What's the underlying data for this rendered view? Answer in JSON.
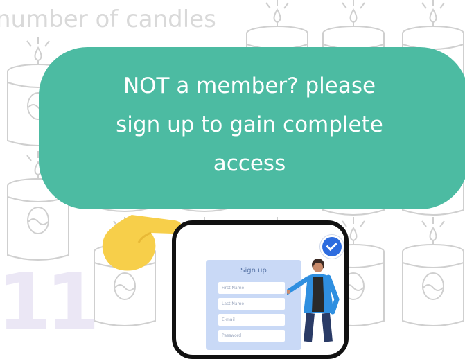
{
  "background": {
    "title": "number of candles",
    "count": "11"
  },
  "banner": {
    "line1": "NOT a member? please",
    "line2": "sign up to gain complete",
    "line3": "access"
  },
  "signup": {
    "title": "Sign up",
    "fields": [
      "First Name",
      "Last Name",
      "E-mail",
      "Password"
    ]
  },
  "colors": {
    "banner": "#4cbba2",
    "hand": "#f7cf4a",
    "card": "#c9d9f6",
    "check": "#2d6cdf"
  },
  "icons": [
    "candle-icon",
    "pointing-hand-icon",
    "phone-icon",
    "checkmark-icon",
    "person-icon"
  ]
}
